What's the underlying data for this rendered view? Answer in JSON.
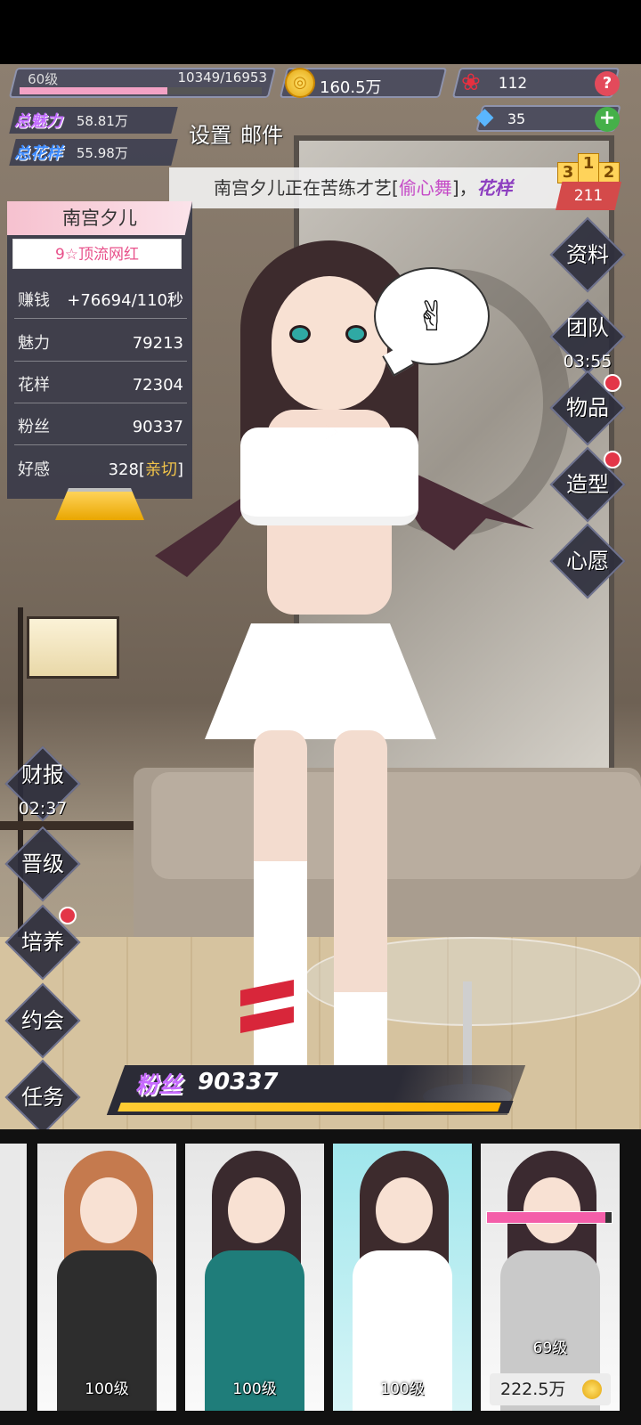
{
  "hud": {
    "level": "60级",
    "exp": "10349/16953",
    "exp_progress": 0.61,
    "coins": "160.5万",
    "roses": "112",
    "diamonds": "35",
    "help_icon": "question-mark-icon",
    "plus_icon": "plus-icon"
  },
  "stats": {
    "charm_label": "总魅力",
    "charm_value": "58.81万",
    "pattern_label": "总花样",
    "pattern_value": "55.98万"
  },
  "toolbar": {
    "settings": "设置",
    "mail": "邮件"
  },
  "ticker": {
    "prefix": "南宫夕儿正在苦练才艺[",
    "skill": "偷心舞",
    "suffix": "]，",
    "tag": "花样"
  },
  "rank": {
    "first": "1",
    "second": "2",
    "third": "3",
    "count": "211"
  },
  "character": {
    "name": "南宫夕儿",
    "title": "9☆顶流网红",
    "rows": [
      {
        "key": "赚钱",
        "value": "+76694/110秒"
      },
      {
        "key": "魅力",
        "value": "79213"
      },
      {
        "key": "花样",
        "value": "72304"
      },
      {
        "key": "粉丝",
        "value": "90337"
      }
    ],
    "affinity_key": "好感",
    "affinity_value": "328[",
    "affinity_level": "亲切",
    "affinity_close": "]"
  },
  "right_menu": {
    "profile": "资料",
    "team": "团队",
    "team_timer": "03:55",
    "items": "物品",
    "styling": "造型",
    "wish": "心愿"
  },
  "left_menu": {
    "report": "财报",
    "report_timer": "02:37",
    "promote": "晋级",
    "train": "培养",
    "date": "约会",
    "tasks": "任务"
  },
  "fans_bar": {
    "label": "粉丝",
    "value": "90337",
    "progress": 0.98
  },
  "cards": [
    {
      "level": "100级",
      "hair": "#c57a4e",
      "outfit": "#2d2d2d"
    },
    {
      "level": "100级",
      "hair": "#3a2a2e",
      "outfit": "#1f7d7a"
    },
    {
      "level": "100级",
      "hair": "#3d2b2d",
      "outfit": "#ffffff"
    },
    {
      "level": "69级",
      "hair": "#3b2a30",
      "outfit": "#c9c9c9",
      "level_progress": 0.95,
      "cost": "222.5万"
    }
  ],
  "colors": {
    "accent_pink": "#f3a2c5",
    "accent_purple": "#c26bff",
    "gold": "#ffcc33",
    "notify_red": "#e33648"
  }
}
